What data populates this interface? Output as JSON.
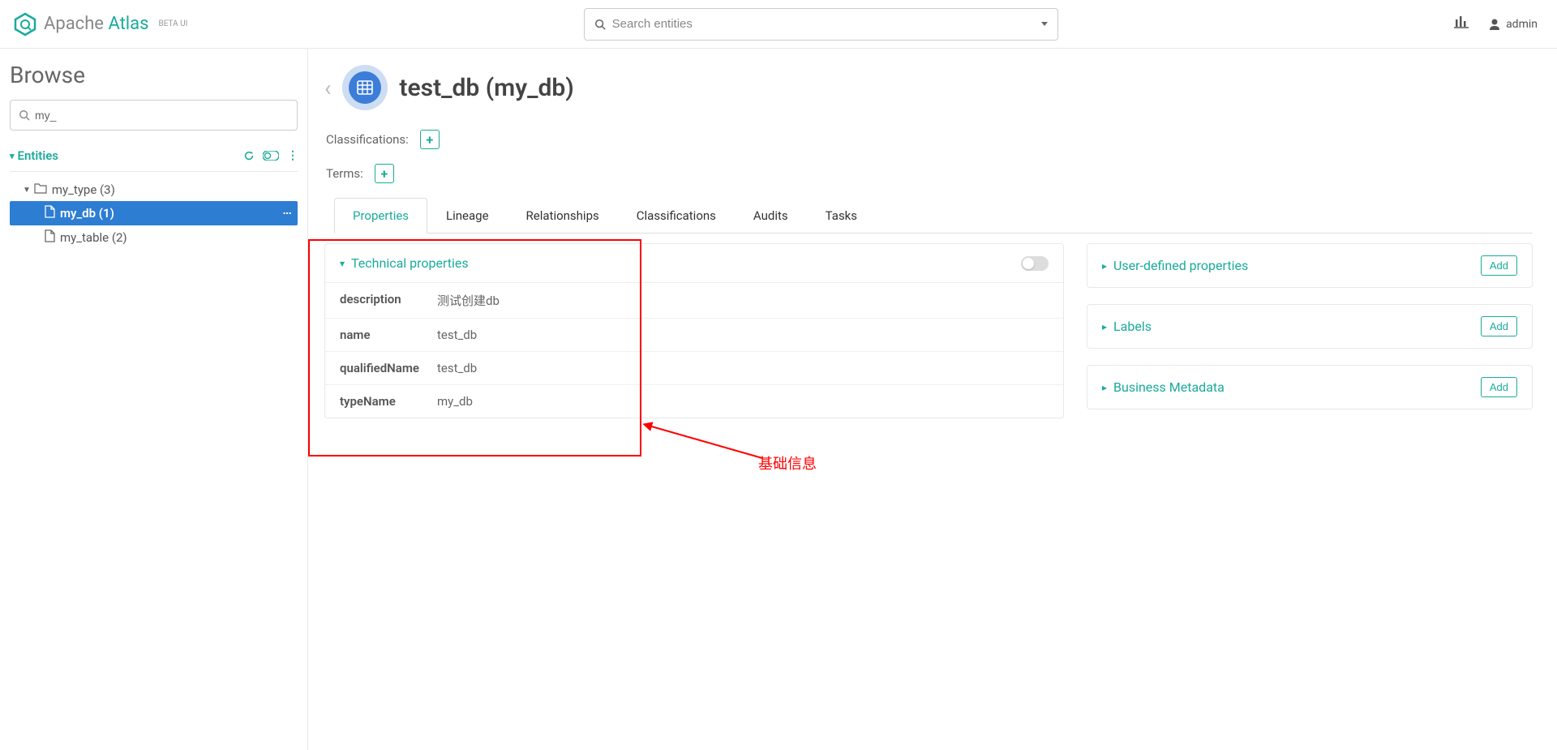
{
  "header": {
    "logo_part1": "Apache ",
    "logo_part2": "Atlas",
    "logo_sub": "BETA UI",
    "search_placeholder": "Search entities",
    "user": "admin"
  },
  "sidebar": {
    "title": "Browse",
    "filter_value": "my_",
    "entities_label": "Entities",
    "tree": [
      {
        "label": "my_type (3)",
        "icon": "folder",
        "level": 0,
        "expanded": true
      },
      {
        "label": "my_db (1)",
        "icon": "file",
        "level": 1,
        "active": true
      },
      {
        "label": "my_table (2)",
        "icon": "file",
        "level": 1
      }
    ]
  },
  "main": {
    "title": "test_db (my_db)",
    "classifications_label": "Classifications:",
    "terms_label": "Terms:",
    "tabs": [
      "Properties",
      "Lineage",
      "Relationships",
      "Classifications",
      "Audits",
      "Tasks"
    ],
    "active_tab": 0,
    "tech_panel": {
      "title": "Technical properties",
      "rows": [
        {
          "k": "description",
          "v": "测试创建db"
        },
        {
          "k": "name",
          "v": "test_db"
        },
        {
          "k": "qualifiedName",
          "v": "test_db"
        },
        {
          "k": "typeName",
          "v": "my_db"
        }
      ]
    },
    "side_panels": [
      {
        "title": "User-defined properties",
        "add": "Add"
      },
      {
        "title": "Labels",
        "add": "Add"
      },
      {
        "title": "Business Metadata",
        "add": "Add"
      }
    ],
    "annotation": "基础信息"
  }
}
